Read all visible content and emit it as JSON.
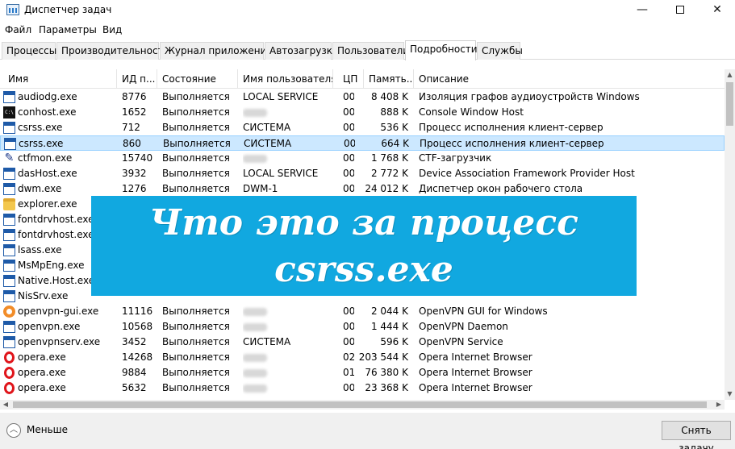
{
  "window": {
    "title": "Диспетчер задач",
    "controls": {
      "minimize": "—",
      "close": "✕"
    }
  },
  "menu": [
    "Файл",
    "Параметры",
    "Вид"
  ],
  "tabs": [
    {
      "label": "Процессы",
      "active": false
    },
    {
      "label": "Производительность",
      "active": false
    },
    {
      "label": "Журнал приложений",
      "active": false
    },
    {
      "label": "Автозагрузка",
      "active": false
    },
    {
      "label": "Пользователи",
      "active": false
    },
    {
      "label": "Подробности",
      "active": true
    },
    {
      "label": "Службы",
      "active": false
    }
  ],
  "columns": {
    "name": "Имя",
    "pid": "ИД п...",
    "state": "Состояние",
    "user": "Имя пользователя",
    "cpu": "ЦП",
    "mem": "Память...",
    "desc": "Описание"
  },
  "rows": [
    {
      "name": "audiodg.exe",
      "pid": "8776",
      "state": "Выполняется",
      "user": "LOCAL SERVICE",
      "cpu": "00",
      "mem": "8 408 K",
      "desc": "Изоляция графов аудиоустройств Windows",
      "icon": "window-icon"
    },
    {
      "name": "conhost.exe",
      "pid": "1652",
      "state": "Выполняется",
      "user": "",
      "cpu": "00",
      "mem": "888 K",
      "desc": "Console Window Host",
      "icon": "console-icon"
    },
    {
      "name": "csrss.exe",
      "pid": "712",
      "state": "Выполняется",
      "user": "СИСТЕМА",
      "cpu": "00",
      "mem": "536 K",
      "desc": "Процесс исполнения клиент-сервер",
      "icon": "window-icon"
    },
    {
      "name": "csrss.exe",
      "pid": "860",
      "state": "Выполняется",
      "user": "СИСТЕМА",
      "cpu": "00",
      "mem": "664 K",
      "desc": "Процесс исполнения клиент-сервер",
      "icon": "window-icon",
      "selected": true
    },
    {
      "name": "ctfmon.exe",
      "pid": "15740",
      "state": "Выполняется",
      "user": "",
      "cpu": "00",
      "mem": "1 768 K",
      "desc": "CTF-загрузчик",
      "icon": "pen-icon"
    },
    {
      "name": "dasHost.exe",
      "pid": "3932",
      "state": "Выполняется",
      "user": "LOCAL SERVICE",
      "cpu": "00",
      "mem": "2 772 K",
      "desc": "Device Association Framework Provider Host",
      "icon": "window-icon"
    },
    {
      "name": "dwm.exe",
      "pid": "1276",
      "state": "Выполняется",
      "user": "DWM-1",
      "cpu": "00",
      "mem": "24 012 K",
      "desc": "Диспетчер окон рабочего стола",
      "icon": "window-icon"
    },
    {
      "name": "explorer.exe",
      "pid": "",
      "state": "",
      "user": "",
      "cpu": "",
      "mem": "",
      "desc": "",
      "icon": "folder-icon"
    },
    {
      "name": "fontdrvhost.exe",
      "pid": "",
      "state": "",
      "user": "",
      "cpu": "",
      "mem": "",
      "desc": "",
      "icon": "window-icon"
    },
    {
      "name": "fontdrvhost.exe",
      "pid": "",
      "state": "",
      "user": "",
      "cpu": "",
      "mem": "",
      "desc": "",
      "icon": "window-icon"
    },
    {
      "name": "lsass.exe",
      "pid": "",
      "state": "",
      "user": "",
      "cpu": "",
      "mem": "",
      "desc": "",
      "icon": "window-icon"
    },
    {
      "name": "MsMpEng.exe",
      "pid": "",
      "state": "",
      "user": "",
      "cpu": "",
      "mem": "",
      "desc": "",
      "icon": "window-icon"
    },
    {
      "name": "Native.Host.exe",
      "pid": "",
      "state": "",
      "user": "",
      "cpu": "",
      "mem": "",
      "desc": "",
      "icon": "window-icon"
    },
    {
      "name": "NisSrv.exe",
      "pid": "",
      "state": "",
      "user": "",
      "cpu": "",
      "mem": "",
      "desc": "",
      "icon": "window-icon"
    },
    {
      "name": "openvpn-gui.exe",
      "pid": "11116",
      "state": "Выполняется",
      "user": "",
      "cpu": "00",
      "mem": "2 044 K",
      "desc": "OpenVPN GUI for Windows",
      "icon": "vpn-icon"
    },
    {
      "name": "openvpn.exe",
      "pid": "10568",
      "state": "Выполняется",
      "user": "",
      "cpu": "00",
      "mem": "1 444 K",
      "desc": "OpenVPN Daemon",
      "icon": "window-icon"
    },
    {
      "name": "openvpnserv.exe",
      "pid": "3452",
      "state": "Выполняется",
      "user": "СИСТЕМА",
      "cpu": "00",
      "mem": "596 K",
      "desc": "OpenVPN Service",
      "icon": "window-icon"
    },
    {
      "name": "opera.exe",
      "pid": "14268",
      "state": "Выполняется",
      "user": "",
      "cpu": "02",
      "mem": "203 544 K",
      "desc": "Opera Internet Browser",
      "icon": "opera-icon"
    },
    {
      "name": "opera.exe",
      "pid": "9884",
      "state": "Выполняется",
      "user": "",
      "cpu": "01",
      "mem": "76 380 K",
      "desc": "Opera Internet Browser",
      "icon": "opera-icon"
    },
    {
      "name": "opera.exe",
      "pid": "5632",
      "state": "Выполняется",
      "user": "",
      "cpu": "00",
      "mem": "23 368 K",
      "desc": "Opera Internet Browser",
      "icon": "opera-icon"
    }
  ],
  "footer": {
    "less_label": "Меньше",
    "end_task_label": "Снять задачу"
  },
  "banner": {
    "line1": "Что это за процесс",
    "line2": "csrss.exe",
    "color": "#11a8e0"
  }
}
